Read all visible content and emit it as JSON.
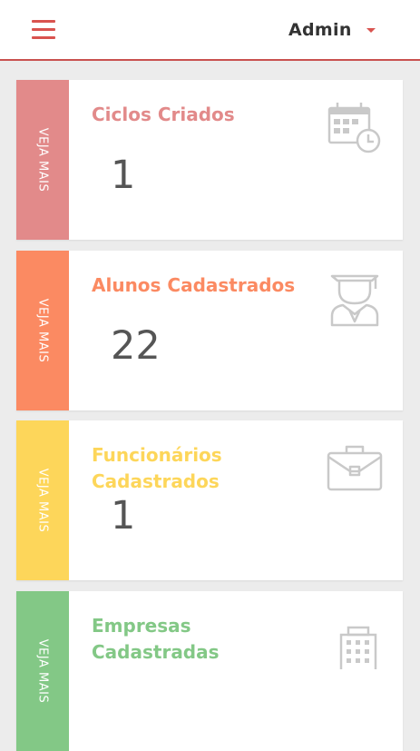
{
  "header": {
    "user_name": "Admin"
  },
  "cards": [
    {
      "side_label": "VEJA MAIS",
      "title": "Ciclos Criados",
      "count": "1",
      "icon": "calendar-clock-icon",
      "color": "#e28a8a"
    },
    {
      "side_label": "VEJA MAIS",
      "title": "Alunos Cadastrados",
      "count": "22",
      "icon": "graduate-icon",
      "color": "#fb8a62"
    },
    {
      "side_label": "VEJA MAIS",
      "title": "Funcionários Cadastrados",
      "count": "1",
      "icon": "briefcase-icon",
      "color": "#fdd65a"
    },
    {
      "side_label": "VEJA MAIS",
      "title": "Empresas Cadastradas",
      "count": "",
      "icon": "building-icon",
      "color": "#83c886"
    }
  ],
  "icon_color": "#c9c9c9",
  "accent_color": "#d9534f"
}
